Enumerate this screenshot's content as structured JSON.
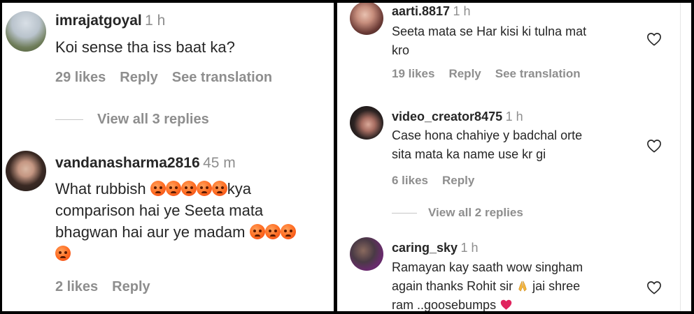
{
  "left_panel": {
    "comments": [
      {
        "username": "imrajatgoyal",
        "time": "1 h",
        "text": "Koi sense tha iss baat ka?",
        "likes": "29 likes",
        "reply": "Reply",
        "see_translation": "See translation"
      },
      {
        "username": "vandanasharma2816",
        "time": "45 m",
        "text_line1": "What rubbish",
        "text_line1_after": "kya",
        "text_line2": "comparison hai ye Seeta mata",
        "text_line3": "bhagwan hai aur ye madam",
        "likes": "2 likes",
        "reply": "Reply"
      }
    ],
    "view_replies": "View all 3 replies"
  },
  "right_panel": {
    "comments": [
      {
        "username": "aarti.8817",
        "time": "1 h",
        "text_line1": "Seeta mata se Har kisi ki tulna mat",
        "text_line2": "kro",
        "likes": "19 likes",
        "reply": "Reply",
        "see_translation": "See translation"
      },
      {
        "username": "video_creator8475",
        "time": "1 h",
        "text_line1": "Case hona chahiye y badchal orte",
        "text_line2": "sita mata ka name use kr gi",
        "likes": "6 likes",
        "reply": "Reply"
      },
      {
        "username": "caring_sky",
        "time": "1 h",
        "text_line1": "Ramayan kay saath wow singham",
        "text_line2": "again thanks Rohit sir",
        "text_line2_after": "jai shree",
        "text_line3": "ram ..goosebumps"
      }
    ],
    "view_replies": "View all 2 replies"
  },
  "icons": {
    "heart": "heart-outline-icon",
    "angry": "angry-face-emoji",
    "folded_hands": "folded-hands-emoji",
    "red_heart": "red-heart-emoji"
  },
  "colors": {
    "text": "#262626",
    "secondary": "#8e8e8e",
    "red_heart": "#e0245e"
  }
}
